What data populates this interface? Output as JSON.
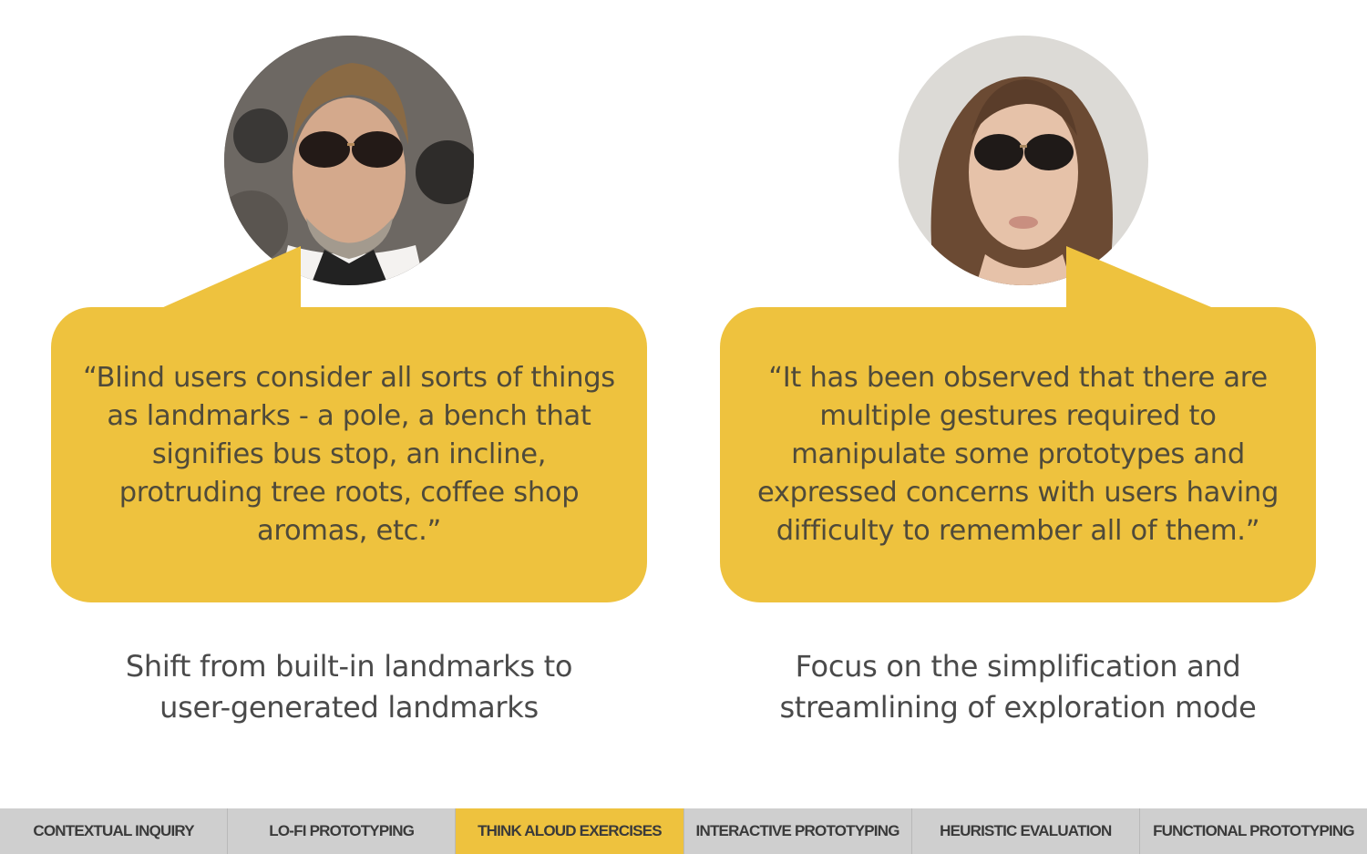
{
  "colors": {
    "accent": "#eec23e",
    "nav_background": "#cfcfcf",
    "quote_text": "#4f4a3a",
    "body_text": "#4a4a4a"
  },
  "personas": [
    {
      "photo": "man-with-aviator-sunglasses-photo",
      "quote": "“Blind users consider all sorts of things\nas landmarks - a pole, a bench that\nsignifies bus stop, an incline,\nprotruding tree roots, coffee shop\naromas, etc.”",
      "takeaway": "Shift from built-in landmarks to\nuser-generated landmarks"
    },
    {
      "photo": "woman-with-aviator-sunglasses-photo",
      "quote": "“It has been observed that there are\nmultiple gestures required to\nmanipulate some prototypes and\nexpressed concerns with users having\ndifficulty to remember all of them.”",
      "takeaway": "Focus on the simplification and\nstreamlining of exploration mode"
    }
  ],
  "nav": {
    "active_index": 2,
    "tabs": [
      "CONTEXTUAL INQUIRY",
      "LO-FI PROTOTYPING",
      "THINK ALOUD EXERCISES",
      "INTERACTIVE PROTOTYPING",
      "HEURISTIC EVALUATION",
      "FUNCTIONAL PROTOTYPING"
    ]
  }
}
